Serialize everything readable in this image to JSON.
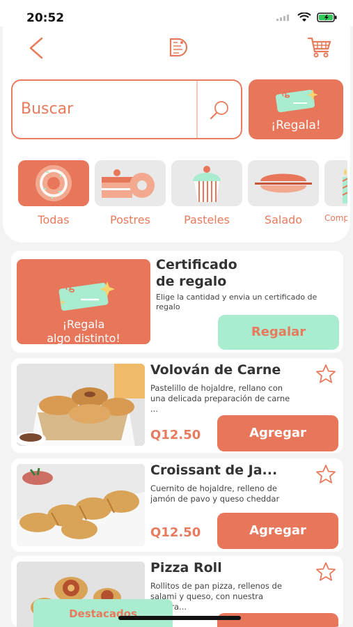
{
  "status_bar": {
    "time": "20:52"
  },
  "search": {
    "placeholder": "Buscar"
  },
  "gift_button": {
    "label": "¡Regala!"
  },
  "categories": [
    {
      "label": "Todas",
      "active": true
    },
    {
      "label": "Postres",
      "active": false
    },
    {
      "label": "Pasteles",
      "active": false
    },
    {
      "label": "Salado",
      "active": false
    },
    {
      "label": "Comp",
      "active": false
    }
  ],
  "gift_card": {
    "image_text_line1": "¡Regala",
    "image_text_line2": "algo distinto!",
    "title_line1": "Certificado",
    "title_line2": "de regalo",
    "description": "Elige la cantidad y envia un certificado de regalo",
    "button_label": "Regalar"
  },
  "products": [
    {
      "title": "Volován de Carne",
      "description": "Pastelillo de hojaldre, rellano con una delicada preparación de carne ...",
      "price": "Q12.50",
      "button_label": "Agregar"
    },
    {
      "title": "Croissant de Ja...",
      "description": "Cuernito de hojaldre, relleno de jamón de pavo y queso cheddar",
      "price": "Q12.50",
      "button_label": "Agregar"
    },
    {
      "title": "Pizza Roll",
      "description": "Rollitos de pan pizza, rellenos de salami y queso, con nuestra salsara...",
      "price": "",
      "button_label": ""
    }
  ],
  "bottom_tab": {
    "label": "Destacados"
  },
  "colors": {
    "accent": "#e8765a",
    "mint": "#a9ecd0",
    "background": "#f3f3f3"
  }
}
